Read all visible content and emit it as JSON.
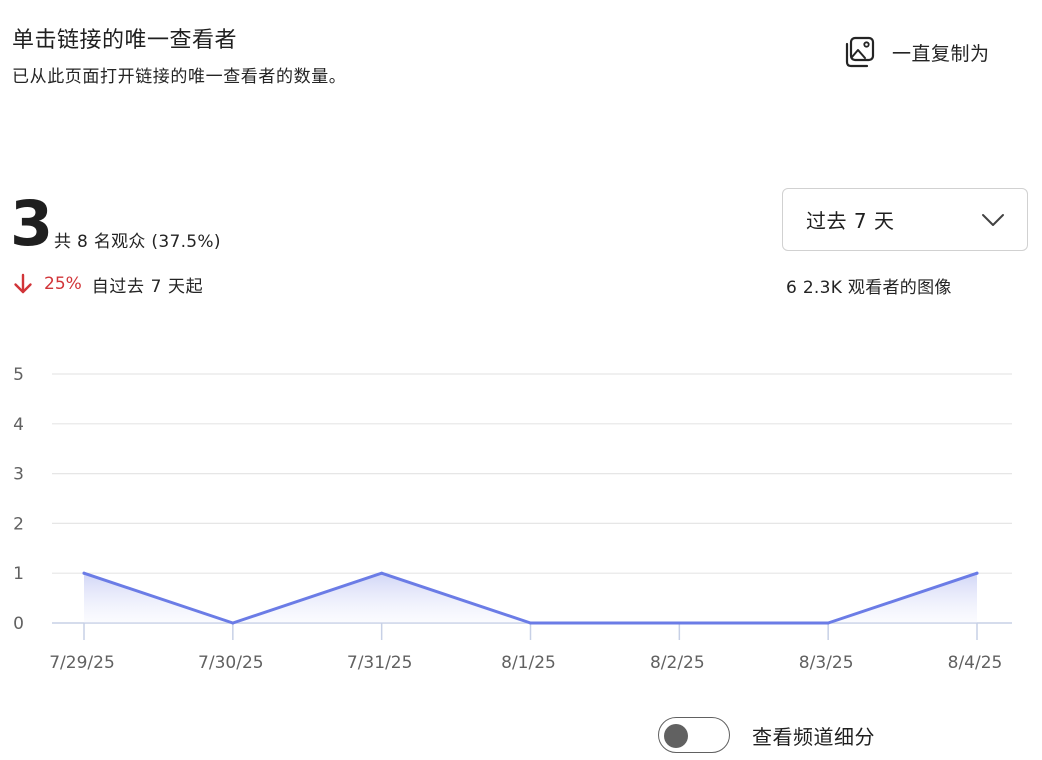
{
  "header": {
    "title": "单击链接的唯一查看者",
    "subtitle": "已从此页面打开链接的唯一查看者的数量。"
  },
  "copy_button": {
    "label": "一直复制为",
    "icon": "image-copy-icon"
  },
  "summary": {
    "value": "3",
    "of_total": "共 8 名观众 (37.5%)",
    "change_percent": "25%",
    "change_direction": "down",
    "change_icon": "arrow-down-icon",
    "change_color": "#d13438",
    "since_text": "自过去 7 天起"
  },
  "range_select": {
    "value": "过去 7 天",
    "icon": "chevron-down-icon"
  },
  "total_viewers": "6 2.3K 观看者的图像",
  "toggle": {
    "label": "查看频道细分",
    "checked": false
  },
  "colors": {
    "series_line": "#6b7ce6",
    "area_fill_top": "#c9cef5",
    "gridline": "#e6e6e6",
    "axis_line": "#c7d0e6"
  },
  "chart_data": {
    "type": "area",
    "x": [
      "7/29/25",
      "7/30/25",
      "7/31/25",
      "8/1/25",
      "8/2/25",
      "8/3/25",
      "8/4/25"
    ],
    "series": [
      {
        "values": [
          1,
          0,
          1,
          0,
          0,
          0,
          1
        ]
      }
    ],
    "yticks": [
      0,
      1,
      2,
      3,
      4,
      5
    ],
    "ylim": [
      0,
      5
    ],
    "grid": true,
    "legend": "none",
    "title": "",
    "xlabel": "",
    "ylabel": ""
  }
}
